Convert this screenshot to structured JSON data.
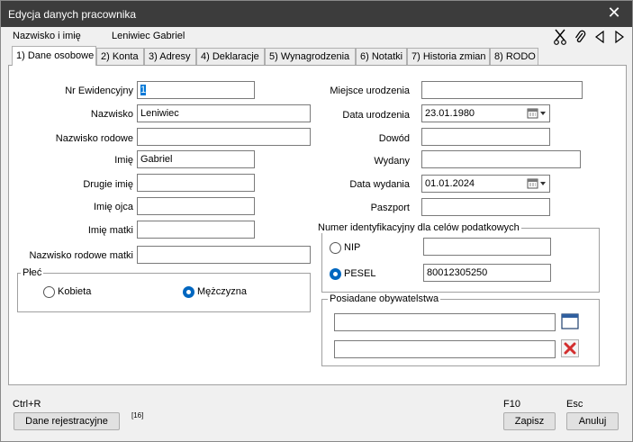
{
  "window": {
    "title": "Edycja danych pracownika"
  },
  "header": {
    "name_label": "Nazwisko i imię",
    "name_value": "Leniwiec Gabriel"
  },
  "tabs": [
    {
      "label": "1) Dane osobowe"
    },
    {
      "label": "2) Konta"
    },
    {
      "label": "3) Adresy"
    },
    {
      "label": "4) Deklaracje"
    },
    {
      "label": "5) Wynagrodzenia"
    },
    {
      "label": "6) Notatki"
    },
    {
      "label": "7) Historia zmian"
    },
    {
      "label": "8) RODO"
    }
  ],
  "left": {
    "nr_ewidencyjny": {
      "label": "Nr Ewidencyjny",
      "value": "1"
    },
    "nazwisko": {
      "label": "Nazwisko",
      "value": "Leniwiec"
    },
    "nazwisko_rodowe": {
      "label": "Nazwisko rodowe",
      "value": ""
    },
    "imie": {
      "label": "Imię",
      "value": "Gabriel"
    },
    "drugie_imie": {
      "label": "Drugie imię",
      "value": ""
    },
    "imie_ojca": {
      "label": "Imię ojca",
      "value": ""
    },
    "imie_matki": {
      "label": "Imię matki",
      "value": ""
    },
    "nazwisko_rodowe_matki": {
      "label": "Nazwisko rodowe matki",
      "value": ""
    }
  },
  "plec": {
    "title": "Płeć",
    "kobieta": "Kobieta",
    "mezczyzna": "Mężczyzna",
    "selected": "Mężczyzna"
  },
  "right": {
    "miejsce_urodzenia": {
      "label": "Miejsce urodzenia",
      "value": ""
    },
    "data_urodzenia": {
      "label": "Data urodzenia",
      "value": "23.01.1980"
    },
    "dowod": {
      "label": "Dowód",
      "value": ""
    },
    "wydany": {
      "label": "Wydany",
      "value": ""
    },
    "data_wydania": {
      "label": "Data wydania",
      "value": "01.01.2024"
    },
    "paszport": {
      "label": "Paszport",
      "value": ""
    }
  },
  "tax": {
    "title": "Numer identyfikacyjny dla celów podatkowych",
    "nip_label": "NIP",
    "nip_value": "",
    "pesel_label": "PESEL",
    "pesel_value": "80012305250",
    "selected": "PESEL"
  },
  "citizenship": {
    "title": "Posiadane obywatelstwa",
    "first": "",
    "second": ""
  },
  "footer": {
    "shortcut_left": "Ctrl+R",
    "dane_btn": "Dane rejestracyjne",
    "counter": "[16]",
    "shortcut_save": "F10",
    "save_btn": "Zapisz",
    "shortcut_cancel": "Esc",
    "cancel_btn": "Anuluj"
  },
  "colors": {
    "titlebar": "#3c3c3c",
    "accent": "#0067c0",
    "delete": "#d32f2f"
  }
}
